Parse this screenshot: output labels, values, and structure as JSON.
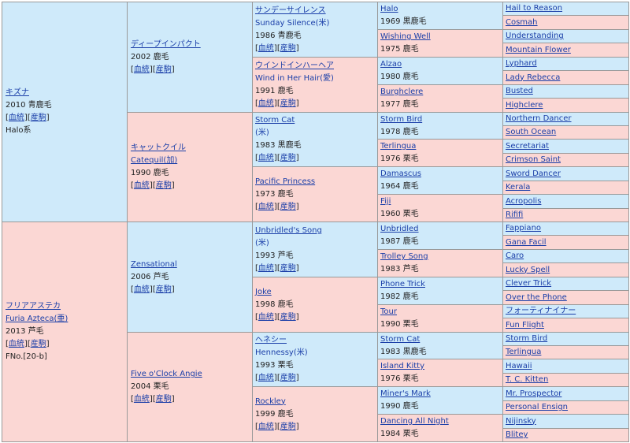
{
  "gen1": [
    {
      "sex": "m",
      "name_jp": "キズナ",
      "year_color": "2010 青鹿毛",
      "links": [
        "血統",
        "産駒"
      ],
      "note": "Halo系"
    },
    {
      "sex": "f",
      "name_jp": "フリアアステカ",
      "name_en": "Furia Azteca(亜)",
      "year_color": "2013 芦毛",
      "links": [
        "血統",
        "産駒"
      ],
      "note": "FNo.[20-b]"
    }
  ],
  "gen2": [
    {
      "sex": "m",
      "name": "ディープインパクト",
      "year_color": "2002 鹿毛",
      "links": [
        "血統",
        "産駒"
      ]
    },
    {
      "sex": "f",
      "name": "キャットクイル",
      "name_en": "Catequil(加)",
      "year_color": "1990 鹿毛",
      "links": [
        "血統",
        "産駒"
      ]
    },
    {
      "sex": "m",
      "name": "Zensational",
      "year_color": "2006 芦毛",
      "links": [
        "血統",
        "産駒"
      ]
    },
    {
      "sex": "f",
      "name": "Five o'Clock Angie",
      "year_color": "2004 栗毛",
      "links": [
        "血統",
        "産駒"
      ]
    }
  ],
  "gen3": [
    {
      "sex": "m",
      "name": "サンデーサイレンス",
      "name_en": "Sunday Silence(米)",
      "year_color": "1986 青鹿毛",
      "links": [
        "血統",
        "産駒"
      ]
    },
    {
      "sex": "f",
      "name": "ウインドインハーヘア",
      "name_en": "Wind in Her Hair(愛)",
      "year_color": "1991 鹿毛",
      "links": [
        "血統",
        "産駒"
      ]
    },
    {
      "sex": "m",
      "name": "Storm Cat",
      "red": true,
      "name_en": "(米)",
      "year_color": "1983 黒鹿毛",
      "links": [
        "血統",
        "産駒"
      ]
    },
    {
      "sex": "f",
      "name": "Pacific Princess",
      "year_color": "1973 鹿毛",
      "links": [
        "血統",
        "産駒"
      ]
    },
    {
      "sex": "m",
      "name": "Unbridled's Song",
      "name_en": "(米)",
      "year_color": "1993 芦毛",
      "links": [
        "血統",
        "産駒"
      ]
    },
    {
      "sex": "f",
      "name": "Joke",
      "year_color": "1998 鹿毛",
      "links": [
        "血統",
        "産駒"
      ]
    },
    {
      "sex": "m",
      "name": "ヘネシー",
      "name_en": "Hennessy(米)",
      "year_color": "1993 栗毛",
      "links": [
        "血統",
        "産駒"
      ]
    },
    {
      "sex": "f",
      "name": "Rockley",
      "year_color": "1999 鹿毛",
      "links": [
        "血統",
        "産駒"
      ]
    }
  ],
  "gen4": [
    {
      "sex": "m",
      "name": "Halo",
      "year_color": "1969 黒鹿毛"
    },
    {
      "sex": "f",
      "name": "Wishing Well",
      "year_color": "1975 鹿毛"
    },
    {
      "sex": "m",
      "name": "Alzao",
      "year_color": "1980 鹿毛"
    },
    {
      "sex": "f",
      "name": "Burghclere",
      "year_color": "1977 鹿毛"
    },
    {
      "sex": "m",
      "name": "Storm Bird",
      "year_color": "1978 鹿毛"
    },
    {
      "sex": "f",
      "name": "Terlingua",
      "year_color": "1976 栗毛"
    },
    {
      "sex": "m",
      "name": "Damascus",
      "year_color": "1964 鹿毛"
    },
    {
      "sex": "f",
      "name": "Fiji",
      "year_color": "1960 栗毛"
    },
    {
      "sex": "m",
      "name": "Unbridled",
      "year_color": "1987 鹿毛"
    },
    {
      "sex": "f",
      "name": "Trolley Song",
      "year_color": "1983 芦毛"
    },
    {
      "sex": "m",
      "name": "Phone Trick",
      "year_color": "1982 鹿毛"
    },
    {
      "sex": "f",
      "name": "Tour",
      "year_color": "1990 栗毛"
    },
    {
      "sex": "m",
      "name": "Storm Cat",
      "red": true,
      "year_color": "1983 黒鹿毛"
    },
    {
      "sex": "f",
      "name": "Island Kitty",
      "year_color": "1976 栗毛"
    },
    {
      "sex": "m",
      "name": "Miner's Mark",
      "year_color": "1990 鹿毛"
    },
    {
      "sex": "f",
      "name": "Dancing All Night",
      "year_color": "1984 栗毛"
    }
  ],
  "gen5": [
    {
      "sex": "m",
      "name": "Hail to Reason"
    },
    {
      "sex": "f",
      "name": "Cosmah"
    },
    {
      "sex": "m",
      "name": "Understanding"
    },
    {
      "sex": "f",
      "name": "Mountain Flower"
    },
    {
      "sex": "m",
      "name": "Lyphard"
    },
    {
      "sex": "f",
      "name": "Lady Rebecca"
    },
    {
      "sex": "m",
      "name": "Busted"
    },
    {
      "sex": "f",
      "name": "Highclere"
    },
    {
      "sex": "m",
      "name": "Northern Dancer"
    },
    {
      "sex": "f",
      "name": "South Ocean"
    },
    {
      "sex": "m",
      "name": "Secretariat"
    },
    {
      "sex": "f",
      "name": "Crimson Saint"
    },
    {
      "sex": "m",
      "name": "Sword Dancer"
    },
    {
      "sex": "f",
      "name": "Kerala"
    },
    {
      "sex": "m",
      "name": "Acropolis"
    },
    {
      "sex": "f",
      "name": "Rififi"
    },
    {
      "sex": "m",
      "name": "Fappiano"
    },
    {
      "sex": "f",
      "name": "Gana Facil"
    },
    {
      "sex": "m",
      "name": "Caro"
    },
    {
      "sex": "f",
      "name": "Lucky Spell"
    },
    {
      "sex": "m",
      "name": "Clever Trick"
    },
    {
      "sex": "f",
      "name": "Over the Phone"
    },
    {
      "sex": "m",
      "name": "フォーティナイナー"
    },
    {
      "sex": "f",
      "name": "Fun Flight"
    },
    {
      "sex": "m",
      "name": "Storm Bird"
    },
    {
      "sex": "f",
      "name": "Terlingua"
    },
    {
      "sex": "m",
      "name": "Hawaii"
    },
    {
      "sex": "f",
      "name": "T. C. Kitten"
    },
    {
      "sex": "m",
      "name": "Mr. Prospector"
    },
    {
      "sex": "f",
      "name": "Personal Ensign"
    },
    {
      "sex": "m",
      "name": "Nijinsky"
    },
    {
      "sex": "f",
      "name": "Blitey"
    }
  ]
}
